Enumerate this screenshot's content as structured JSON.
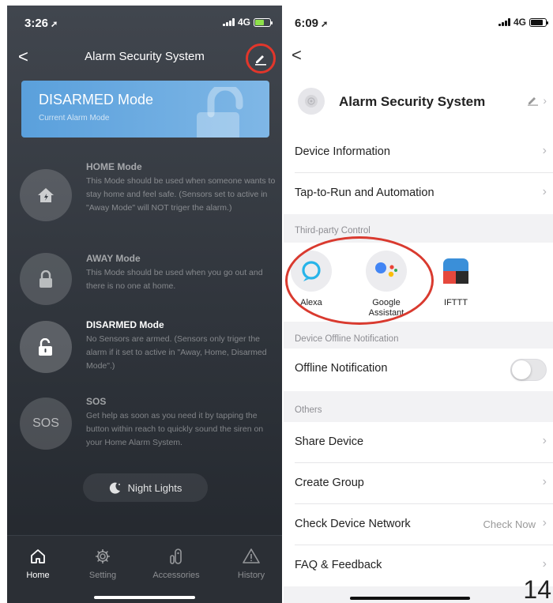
{
  "left_screen": {
    "status": {
      "time": "3:26",
      "network": "4G"
    },
    "nav": {
      "back": "<",
      "title": "Alarm Security System"
    },
    "current_mode": {
      "title": "DISARMED Mode",
      "subtitle": "Current Alarm Mode"
    },
    "modes": [
      {
        "title": "HOME Mode",
        "description": "This Mode should be used when someone wants to stay home and feel safe. (Sensors set to active in \"Away Mode\" will NOT triger the alarm.)",
        "icon": "home-icon"
      },
      {
        "title": "AWAY Mode",
        "description": "This Mode should be used when you go out and there is no one at home.",
        "icon": "lock-icon"
      },
      {
        "title": "DISARMED Mode",
        "description": "No Sensors are armed. (Sensors only triger the alarm if it set to active in \"Away, Home, Disarmed Mode\".)",
        "icon": "unlock-icon"
      },
      {
        "title": "SOS",
        "description": "Get help as soon as you need it by tapping the button within reach to quickly sound the siren on your Home Alarm System.",
        "icon_text": "SOS"
      }
    ],
    "night_lights": "Night Lights",
    "tabs": [
      {
        "label": "Home",
        "icon": "home-icon"
      },
      {
        "label": "Setting",
        "icon": "gear-icon"
      },
      {
        "label": "Accessories",
        "icon": "accessories-icon"
      },
      {
        "label": "History",
        "icon": "warning-icon"
      }
    ],
    "colors": {
      "card_blue": "#6aaae0",
      "highlight_red": "#e2362b"
    }
  },
  "right_screen": {
    "status": {
      "time": "6:09",
      "network": "4G"
    },
    "nav": {
      "back": "<"
    },
    "device": {
      "name": "Alarm Security System"
    },
    "rows_top": [
      {
        "label": "Device Information"
      },
      {
        "label": "Tap-to-Run and Automation"
      }
    ],
    "third_party": {
      "header": "Third-party Control",
      "items": [
        {
          "label": "Alexa",
          "icon": "alexa-icon"
        },
        {
          "label": "Google Assistant",
          "icon": "google-assistant-icon"
        },
        {
          "label": "IFTTT",
          "icon": "ifttt-icon"
        }
      ]
    },
    "offline": {
      "header": "Device Offline Notification",
      "label": "Offline Notification",
      "enabled": false
    },
    "others": {
      "header": "Others",
      "rows": [
        {
          "label": "Share Device",
          "value": ""
        },
        {
          "label": "Create Group",
          "value": ""
        },
        {
          "label": "Check Device Network",
          "value": "Check Now"
        },
        {
          "label": "FAQ & Feedback",
          "value": ""
        }
      ]
    }
  },
  "page_number": "14"
}
